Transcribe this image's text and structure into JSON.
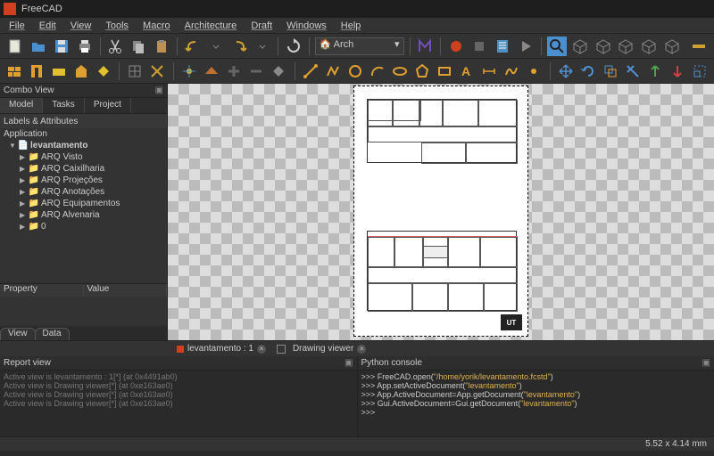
{
  "title": "FreeCAD",
  "menus": [
    "File",
    "Edit",
    "View",
    "Tools",
    "Macro",
    "Architecture",
    "Draft",
    "Windows",
    "Help"
  ],
  "workbench": "Arch",
  "combo": {
    "title": "Combo View",
    "tabs": [
      "Model",
      "Tasks",
      "Project"
    ],
    "labels_hdr": "Labels & Attributes",
    "app_hdr": "Application",
    "root": "levantamento",
    "items": [
      "ARQ Visto",
      "ARQ Caixilharia",
      "ARQ Projeções",
      "ARQ Anotações",
      "ARQ Equipamentos",
      "ARQ Alvenaria",
      "0"
    ],
    "prop_cols": [
      "Property",
      "Value"
    ],
    "view_tabs": [
      "View",
      "Data"
    ]
  },
  "filetabs": [
    {
      "label": "levantamento : 1"
    },
    {
      "label": "Drawing viewer"
    }
  ],
  "report": {
    "title": "Report view",
    "lines": [
      "Active view is levantamento : 1[*] (at 0x4491ab0)",
      "Active view is Drawing viewer[*] (at 0xe163ae0)",
      "Active view is Drawing viewer[*] (at 0xe163ae0)",
      "Active view is Drawing viewer[*] (at 0xe163ae0)"
    ]
  },
  "console": {
    "title": "Python console",
    "lines": [
      {
        "p": ">>> ",
        "f": "FreeCAD.open(",
        "s": "\"/home/yorik/levantamento.fcstd\"",
        "e": ")"
      },
      {
        "p": ">>> ",
        "f": "App.setActiveDocument(",
        "s": "\"levantamento\"",
        "e": ")"
      },
      {
        "p": ">>> ",
        "f": "App.ActiveDocument=App.getDocument(",
        "s": "\"levantamento\"",
        "e": ")"
      },
      {
        "p": ">>> ",
        "f": "Gui.ActiveDocument=Gui.getDocument(",
        "s": "\"levantamento\"",
        "e": ")"
      },
      {
        "p": ">>> ",
        "f": "",
        "s": "",
        "e": ""
      }
    ]
  },
  "status": "5.52 x 4.14  mm"
}
